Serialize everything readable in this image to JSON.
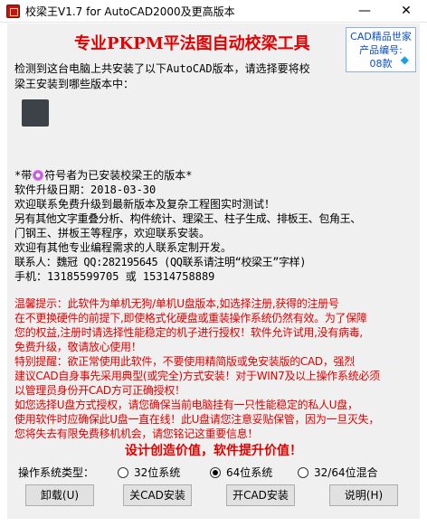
{
  "window": {
    "title": "校梁王V1.7 for AutoCAD2000及更高版本",
    "minimize_glyph": "—",
    "close_glyph": "✕"
  },
  "banner": {
    "title": "专业PKPM平法图自动校梁工具",
    "badge_line1": "CAD精品世家",
    "badge_line2": "产品编号:",
    "badge_line3": "08款",
    "badge_icon": "diamond-icon"
  },
  "prompt": {
    "line1": "检测到这台电脑上共安装了以下AutoCAD版本，请选择要将校",
    "line2": "梁王安装到哪些版本中："
  },
  "info": {
    "legend_prefix": "*带",
    "legend_suffix": "符号者为已安装校梁王的版本*",
    "upgrade_date": "软件升级日期：2018-03-30",
    "welcome_trial": "欢迎联系免费升级到最新版本及复杂工程图实时测试！",
    "other_software_1": "另有其他文字重叠分析、构件统计、理梁王、柱子生成、排板王、包角王、",
    "other_software_2": "门钢王、拼板王等程序，欢迎联系安装。",
    "custom_dev": "欢迎有其他专业编程需求的人联系定制开发。",
    "contact": "联系人：魏冠 QQ:282195645 (QQ联系请注明“校梁王”字样)",
    "phone": "手机：13185599705 或 15314758889"
  },
  "notice": {
    "lines": [
      "    温馨提示：此软件为单机无狗/单机U盘版本,如选择注册,获得的注册号",
      "在不更换硬件的前提下,即使格式化硬盘或重装操作系统仍然有效。为了保障",
      "您的权益,注册时请选择性能稳定的机子进行授权！软件允许试用,没有病毒,",
      "免费升级，敬请放心使用！",
      "    特别提醒：欲正常使用此软件，不要使用精简版或免安装版的CAD，强烈",
      "建议CAD自身事先采用典型(或完全)方式安装！对于WIN7及以上操作系统必须",
      "以管理员身份开CAD方可正确授权！",
      "    如您选择U盘方式授权，请您确保当前电脑挂有一只性能稳定的私人U盘，",
      "使用软件时应确保此U盘一直在线！此U盘请您注意妥贴保管，因为一旦灭失，",
      "您将失去有限免费移机机会，请您铭记这重要信息！"
    ]
  },
  "slogan": "设计创造价值，软件提升价值！",
  "os_type": {
    "label": "操作系统类型：",
    "options": [
      {
        "label": "32位系统",
        "selected": false
      },
      {
        "label": "64位系统",
        "selected": true
      },
      {
        "label": "32/64位混合",
        "selected": false
      }
    ]
  },
  "buttons": {
    "uninstall": "卸载(U)",
    "close_cad_install": "关CAD安装",
    "open_cad_install": "开CAD安装",
    "help": "说明(H)"
  },
  "colors": {
    "accent_red": "#e40000",
    "badge_blue": "#0a4ec4",
    "window_bg": "#f0f0f0"
  }
}
